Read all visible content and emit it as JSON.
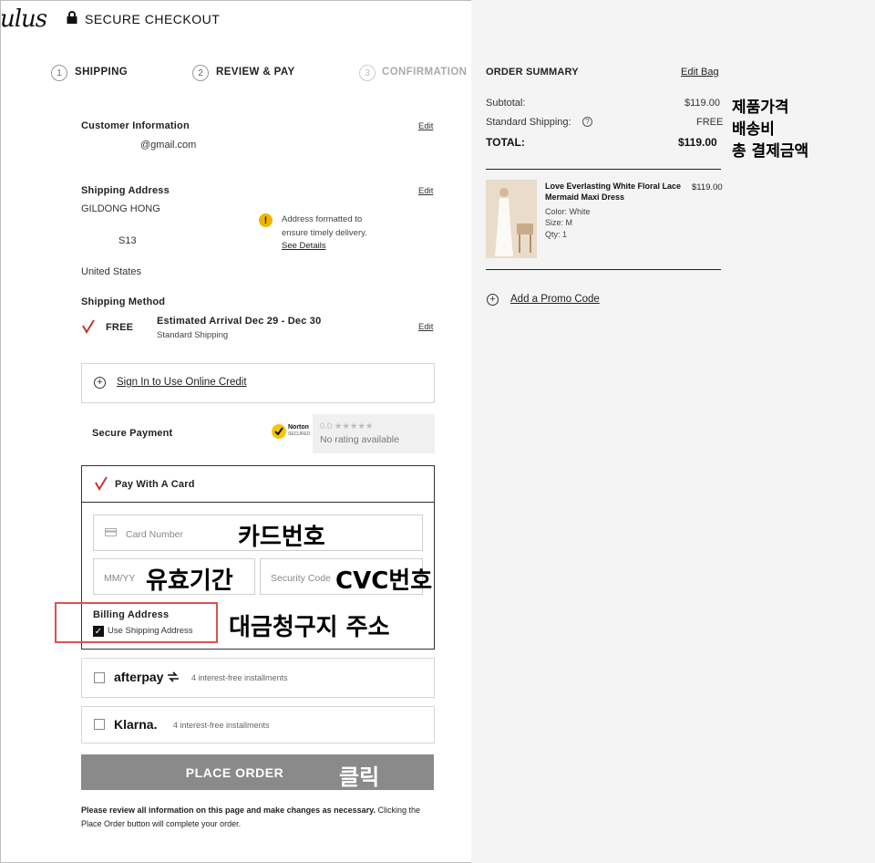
{
  "header": {
    "logo_text": "ulus",
    "secure_checkout": "SECURE CHECKOUT"
  },
  "steps": [
    {
      "number": "1",
      "label": "SHIPPING"
    },
    {
      "number": "2",
      "label": "REVIEW & PAY"
    },
    {
      "number": "3",
      "label": "CONFIRMATION"
    }
  ],
  "customer": {
    "heading": "Customer Information",
    "email": "@gmail.com",
    "edit": "Edit"
  },
  "shipping_address": {
    "heading": "Shipping Address",
    "name": "GILDONG HONG",
    "line": "S13",
    "country": "United States",
    "edit": "Edit",
    "notice_line1": "Address formatted to",
    "notice_line2": "ensure timely delivery.",
    "see_details": "See Details"
  },
  "shipping_method": {
    "heading": "Shipping Method",
    "price": "FREE",
    "arrival": "Estimated Arrival Dec 29 - Dec 30",
    "type": "Standard Shipping",
    "edit": "Edit"
  },
  "online_credit": {
    "label": "Sign In to Use Online Credit"
  },
  "secure_payment": {
    "label": "Secure Payment",
    "norton_line1": "Norton",
    "norton_line2": "SECURED",
    "rating": "0.0 ★★★★★",
    "no_rating": "No rating available"
  },
  "card": {
    "heading": "Pay With A Card",
    "card_number_placeholder": "Card Number",
    "expiry_placeholder": "MM/YY",
    "cvc_placeholder": "Security Code",
    "billing_heading": "Billing Address",
    "use_shipping": "Use Shipping Address"
  },
  "afterpay": {
    "brand": "afterpay",
    "note": "4 interest-free installments"
  },
  "klarna": {
    "brand": "Klarna.",
    "note": "4 interest-free installments"
  },
  "place_order": {
    "label": "PLACE ORDER",
    "disclaimer_bold": "Please review all information on this page and make changes as necessary.",
    "disclaimer_rest": " Clicking the Place Order button will complete your order."
  },
  "summary": {
    "heading": "ORDER SUMMARY",
    "edit_bag": "Edit Bag",
    "subtotal_label": "Subtotal:",
    "subtotal_value": "$119.00",
    "shipping_label": "Standard Shipping:",
    "shipping_value": "FREE",
    "total_label": "TOTAL:",
    "total_value": "$119.00",
    "product_name_1": "Love Everlasting White Floral Lace",
    "product_name_2": "Mermaid Maxi Dress",
    "product_price": "$119.00",
    "color": "Color: White",
    "size": "Size: M",
    "qty": "Qty: 1",
    "promo": "Add a Promo Code"
  },
  "annotations": {
    "product_price": "제품가격",
    "shipping_fee": "배송비",
    "total_amount": "총 결제금액",
    "card_number": "카드번호",
    "expiry": "유효기간",
    "cvc": "CVC번호",
    "billing": "대금청구지 주소",
    "click": "클릭"
  },
  "colors": {
    "accent_red": "#c0392b",
    "annotation_box": "#d9534f",
    "button_gray": "#8a8a8a",
    "panel_bg": "#f4f4f4"
  }
}
